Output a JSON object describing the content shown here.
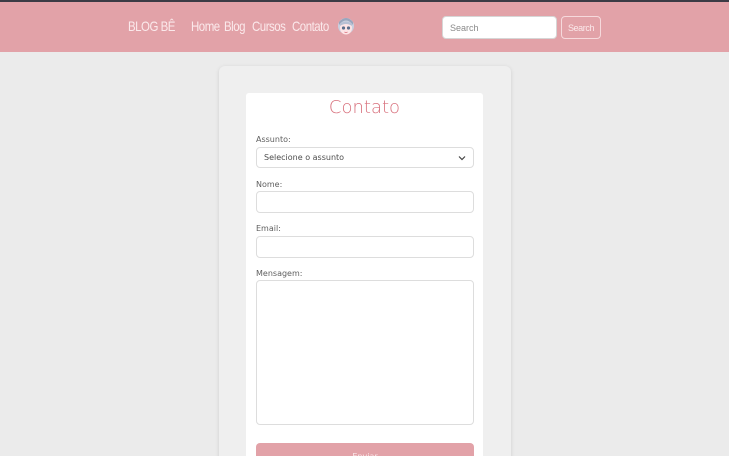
{
  "nav": {
    "brand": "BLOG BÊ",
    "links": [
      "Home",
      "Blog",
      "Cursos",
      "Contato"
    ],
    "avatar_icon": "anime-avatar-icon"
  },
  "search": {
    "placeholder": "Search",
    "button_label": "Search"
  },
  "form": {
    "title": "Contato",
    "assunto_label": "Assunto:",
    "assunto_value": "Selecione o assunto",
    "nome_label": "Nome:",
    "nome_value": "",
    "email_label": "Email:",
    "email_value": "",
    "mensagem_label": "Mensagem:",
    "mensagem_value": "",
    "submit_label": "Enviar"
  },
  "colors": {
    "navbar": "#e2a2a8",
    "accent_title": "#d8707c",
    "page_background": "#ebebeb"
  }
}
